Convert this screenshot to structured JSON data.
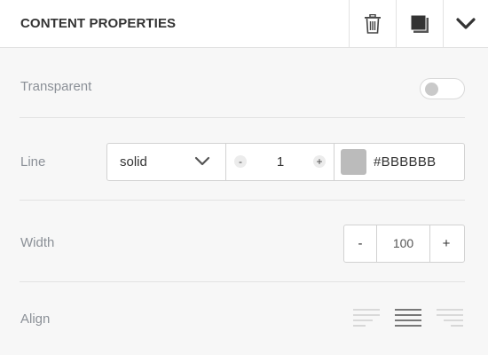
{
  "header": {
    "title": "CONTENT PROPERTIES",
    "buttons": [
      {
        "name": "delete",
        "icon": "trash-icon"
      },
      {
        "name": "duplicate",
        "icon": "copy-icon"
      },
      {
        "name": "collapse",
        "icon": "chevron-down-icon"
      }
    ]
  },
  "properties": {
    "transparent": {
      "label": "Transparent",
      "enabled": false
    },
    "line": {
      "label": "Line",
      "style": "solid",
      "thickness": "1",
      "minus": "-",
      "plus": "+",
      "color": "#BBBBBB"
    },
    "width": {
      "label": "Width",
      "value": "100",
      "minus": "-",
      "plus": "+"
    },
    "align": {
      "label": "Align",
      "options": [
        "left",
        "center",
        "right"
      ],
      "selected": "center"
    }
  },
  "colors": {
    "header_bg": "#ffffff",
    "panel_bg": "#f7f7f7",
    "label": "#8b9097",
    "border": "#d2d2d2",
    "swatch": "#BBBBBB"
  }
}
